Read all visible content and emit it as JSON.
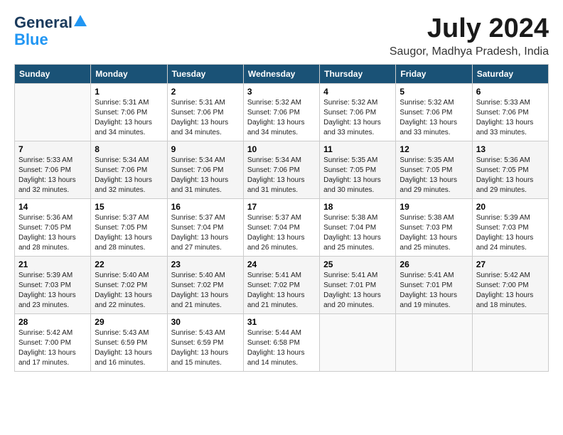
{
  "logo": {
    "line1": "General",
    "line2": "Blue"
  },
  "title": {
    "month_year": "July 2024",
    "location": "Saugor, Madhya Pradesh, India"
  },
  "headers": [
    "Sunday",
    "Monday",
    "Tuesday",
    "Wednesday",
    "Thursday",
    "Friday",
    "Saturday"
  ],
  "weeks": [
    {
      "bg": "light",
      "days": [
        {
          "num": "",
          "info": ""
        },
        {
          "num": "1",
          "info": "Sunrise: 5:31 AM\nSunset: 7:06 PM\nDaylight: 13 hours\nand 34 minutes."
        },
        {
          "num": "2",
          "info": "Sunrise: 5:31 AM\nSunset: 7:06 PM\nDaylight: 13 hours\nand 34 minutes."
        },
        {
          "num": "3",
          "info": "Sunrise: 5:32 AM\nSunset: 7:06 PM\nDaylight: 13 hours\nand 34 minutes."
        },
        {
          "num": "4",
          "info": "Sunrise: 5:32 AM\nSunset: 7:06 PM\nDaylight: 13 hours\nand 33 minutes."
        },
        {
          "num": "5",
          "info": "Sunrise: 5:32 AM\nSunset: 7:06 PM\nDaylight: 13 hours\nand 33 minutes."
        },
        {
          "num": "6",
          "info": "Sunrise: 5:33 AM\nSunset: 7:06 PM\nDaylight: 13 hours\nand 33 minutes."
        }
      ]
    },
    {
      "bg": "mid",
      "days": [
        {
          "num": "7",
          "info": "Sunrise: 5:33 AM\nSunset: 7:06 PM\nDaylight: 13 hours\nand 32 minutes."
        },
        {
          "num": "8",
          "info": "Sunrise: 5:34 AM\nSunset: 7:06 PM\nDaylight: 13 hours\nand 32 minutes."
        },
        {
          "num": "9",
          "info": "Sunrise: 5:34 AM\nSunset: 7:06 PM\nDaylight: 13 hours\nand 31 minutes."
        },
        {
          "num": "10",
          "info": "Sunrise: 5:34 AM\nSunset: 7:06 PM\nDaylight: 13 hours\nand 31 minutes."
        },
        {
          "num": "11",
          "info": "Sunrise: 5:35 AM\nSunset: 7:05 PM\nDaylight: 13 hours\nand 30 minutes."
        },
        {
          "num": "12",
          "info": "Sunrise: 5:35 AM\nSunset: 7:05 PM\nDaylight: 13 hours\nand 29 minutes."
        },
        {
          "num": "13",
          "info": "Sunrise: 5:36 AM\nSunset: 7:05 PM\nDaylight: 13 hours\nand 29 minutes."
        }
      ]
    },
    {
      "bg": "light",
      "days": [
        {
          "num": "14",
          "info": "Sunrise: 5:36 AM\nSunset: 7:05 PM\nDaylight: 13 hours\nand 28 minutes."
        },
        {
          "num": "15",
          "info": "Sunrise: 5:37 AM\nSunset: 7:05 PM\nDaylight: 13 hours\nand 28 minutes."
        },
        {
          "num": "16",
          "info": "Sunrise: 5:37 AM\nSunset: 7:04 PM\nDaylight: 13 hours\nand 27 minutes."
        },
        {
          "num": "17",
          "info": "Sunrise: 5:37 AM\nSunset: 7:04 PM\nDaylight: 13 hours\nand 26 minutes."
        },
        {
          "num": "18",
          "info": "Sunrise: 5:38 AM\nSunset: 7:04 PM\nDaylight: 13 hours\nand 25 minutes."
        },
        {
          "num": "19",
          "info": "Sunrise: 5:38 AM\nSunset: 7:03 PM\nDaylight: 13 hours\nand 25 minutes."
        },
        {
          "num": "20",
          "info": "Sunrise: 5:39 AM\nSunset: 7:03 PM\nDaylight: 13 hours\nand 24 minutes."
        }
      ]
    },
    {
      "bg": "mid",
      "days": [
        {
          "num": "21",
          "info": "Sunrise: 5:39 AM\nSunset: 7:03 PM\nDaylight: 13 hours\nand 23 minutes."
        },
        {
          "num": "22",
          "info": "Sunrise: 5:40 AM\nSunset: 7:02 PM\nDaylight: 13 hours\nand 22 minutes."
        },
        {
          "num": "23",
          "info": "Sunrise: 5:40 AM\nSunset: 7:02 PM\nDaylight: 13 hours\nand 21 minutes."
        },
        {
          "num": "24",
          "info": "Sunrise: 5:41 AM\nSunset: 7:02 PM\nDaylight: 13 hours\nand 21 minutes."
        },
        {
          "num": "25",
          "info": "Sunrise: 5:41 AM\nSunset: 7:01 PM\nDaylight: 13 hours\nand 20 minutes."
        },
        {
          "num": "26",
          "info": "Sunrise: 5:41 AM\nSunset: 7:01 PM\nDaylight: 13 hours\nand 19 minutes."
        },
        {
          "num": "27",
          "info": "Sunrise: 5:42 AM\nSunset: 7:00 PM\nDaylight: 13 hours\nand 18 minutes."
        }
      ]
    },
    {
      "bg": "light",
      "days": [
        {
          "num": "28",
          "info": "Sunrise: 5:42 AM\nSunset: 7:00 PM\nDaylight: 13 hours\nand 17 minutes."
        },
        {
          "num": "29",
          "info": "Sunrise: 5:43 AM\nSunset: 6:59 PM\nDaylight: 13 hours\nand 16 minutes."
        },
        {
          "num": "30",
          "info": "Sunrise: 5:43 AM\nSunset: 6:59 PM\nDaylight: 13 hours\nand 15 minutes."
        },
        {
          "num": "31",
          "info": "Sunrise: 5:44 AM\nSunset: 6:58 PM\nDaylight: 13 hours\nand 14 minutes."
        },
        {
          "num": "",
          "info": ""
        },
        {
          "num": "",
          "info": ""
        },
        {
          "num": "",
          "info": ""
        }
      ]
    }
  ]
}
